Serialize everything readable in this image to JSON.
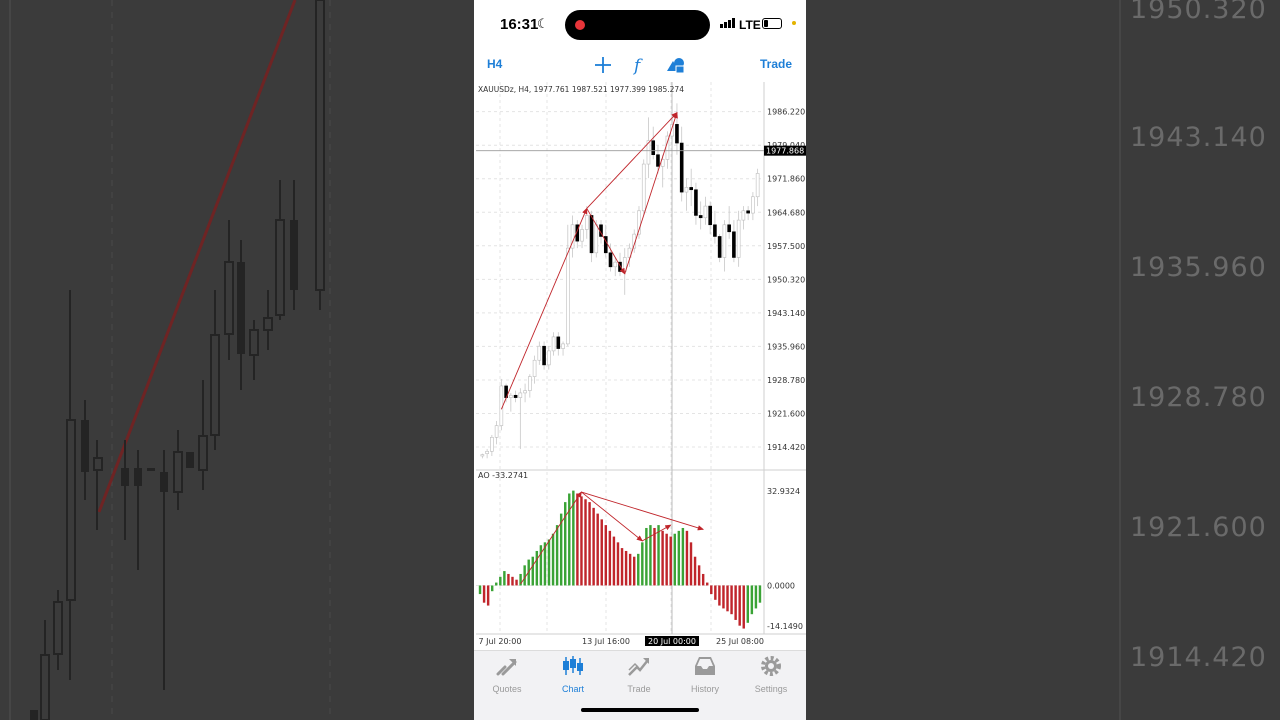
{
  "status_bar": {
    "time": "16:31",
    "network": "LTE"
  },
  "toolbar": {
    "timeframe": "H4",
    "trade_label": "Trade",
    "icons": [
      "crosshair-icon",
      "function-icon",
      "shapes-icon"
    ]
  },
  "background": {
    "tick_labels": [
      "1950.320",
      "1943.140",
      "1935.960",
      "1928.780",
      "1921.600",
      "1914.420"
    ]
  },
  "chart_data": [
    {
      "type": "candlestick",
      "title": "XAUUSDz, H4, 1977.761 1987.521 1977.399 1985.274",
      "current_price": "1977.868",
      "y_ticks": [
        "1986.220",
        "1979.040",
        "1971.860",
        "1964.680",
        "1957.500",
        "1950.320",
        "1943.140",
        "1935.960",
        "1928.780",
        "1921.600",
        "1914.420"
      ],
      "ylim": [
        1909.5,
        1990.0
      ],
      "x_ticks": [
        "7 Jul 20:00",
        "13 Jul 16:00",
        "20 Jul 00:00",
        "25 Jul 08:00"
      ],
      "highlighted_x": "20 Jul 00:00",
      "candles": [
        [
          1912.5,
          1913.0,
          1912.0,
          1912.8
        ],
        [
          1913.0,
          1914.0,
          1912.0,
          1913.5
        ],
        [
          1913.5,
          1917.0,
          1912.5,
          1916.5
        ],
        [
          1916.5,
          1920.0,
          1915.0,
          1919.0
        ],
        [
          1919.0,
          1929.0,
          1918.0,
          1927.5
        ],
        [
          1927.5,
          1928.0,
          1924.0,
          1925.0
        ],
        [
          1925.0,
          1926.0,
          1922.0,
          1925.5
        ],
        [
          1925.5,
          1926.5,
          1924.0,
          1925.0
        ],
        [
          1925.0,
          1927.0,
          1914.0,
          1926.0
        ],
        [
          1926.0,
          1928.0,
          1924.0,
          1926.5
        ],
        [
          1926.5,
          1930.0,
          1925.0,
          1929.5
        ],
        [
          1929.5,
          1934.0,
          1928.0,
          1933.0
        ],
        [
          1933.0,
          1937.0,
          1932.0,
          1936.0
        ],
        [
          1936.0,
          1937.0,
          1931.0,
          1932.0
        ],
        [
          1932.0,
          1936.0,
          1931.0,
          1935.0
        ],
        [
          1935.0,
          1939.0,
          1934.0,
          1938.0
        ],
        [
          1938.0,
          1939.0,
          1934.0,
          1935.5
        ],
        [
          1935.5,
          1937.0,
          1934.0,
          1936.5
        ],
        [
          1936.5,
          1962.0,
          1936.0,
          1957.0
        ],
        [
          1957.0,
          1964.0,
          1955.0,
          1962.0
        ],
        [
          1962.0,
          1963.0,
          1957.0,
          1958.5
        ],
        [
          1958.5,
          1962.0,
          1957.0,
          1961.0
        ],
        [
          1961.0,
          1966.0,
          1959.0,
          1964.0
        ],
        [
          1964.0,
          1965.0,
          1954.0,
          1956.0
        ],
        [
          1956.0,
          1963.0,
          1955.0,
          1962.0
        ],
        [
          1962.0,
          1963.0,
          1958.0,
          1959.5
        ],
        [
          1959.5,
          1962.0,
          1955.0,
          1956.0
        ],
        [
          1956.0,
          1958.0,
          1952.0,
          1953.0
        ],
        [
          1953.0,
          1955.0,
          1951.0,
          1954.0
        ],
        [
          1954.0,
          1956.0,
          1951.0,
          1952.0
        ],
        [
          1952.0,
          1957.0,
          1947.0,
          1955.0
        ],
        [
          1955.0,
          1958.0,
          1953.0,
          1957.0
        ],
        [
          1957.0,
          1961.0,
          1956.0,
          1960.0
        ],
        [
          1960.0,
          1966.0,
          1959.0,
          1965.0
        ],
        [
          1965.0,
          1976.0,
          1964.0,
          1975.0
        ],
        [
          1975.0,
          1985.0,
          1972.0,
          1980.0
        ],
        [
          1980.0,
          1983.0,
          1976.0,
          1977.0
        ],
        [
          1977.0,
          1979.0,
          1973.0,
          1974.5
        ],
        [
          1974.5,
          1977.0,
          1970.0,
          1976.0
        ],
        [
          1976.0,
          1982.0,
          1974.0,
          1981.0
        ],
        [
          1981.0,
          1987.0,
          1978.0,
          1983.5
        ],
        [
          1983.5,
          1988.0,
          1977.0,
          1979.5
        ],
        [
          1979.5,
          1983.0,
          1967.0,
          1969.0
        ],
        [
          1969.0,
          1972.0,
          1965.0,
          1970.0
        ],
        [
          1970.0,
          1974.0,
          1966.0,
          1969.5
        ],
        [
          1969.5,
          1971.0,
          1962.0,
          1964.0
        ],
        [
          1964.0,
          1967.0,
          1961.0,
          1963.5
        ],
        [
          1963.5,
          1968.0,
          1962.0,
          1966.0
        ],
        [
          1966.0,
          1967.0,
          1960.0,
          1962.0
        ],
        [
          1962.0,
          1965.0,
          1958.0,
          1959.5
        ],
        [
          1959.5,
          1960.0,
          1954.0,
          1955.0
        ],
        [
          1955.0,
          1963.0,
          1952.0,
          1962.0
        ],
        [
          1962.0,
          1966.0,
          1959.0,
          1960.5
        ],
        [
          1960.5,
          1963.0,
          1954.0,
          1955.0
        ],
        [
          1955.0,
          1965.0,
          1953.0,
          1963.0
        ],
        [
          1963.0,
          1966.0,
          1961.0,
          1965.0
        ],
        [
          1965.0,
          1966.0,
          1963.0,
          1964.5
        ],
        [
          1964.5,
          1969.0,
          1963.0,
          1968.0
        ],
        [
          1968.0,
          1974.0,
          1966.0,
          1973.0
        ]
      ],
      "annotations": [
        {
          "kind": "arrow",
          "from": [
            4,
            1922.5
          ],
          "to": [
            22,
            1965.5
          ]
        },
        {
          "kind": "arrow",
          "from": [
            22,
            1965.5
          ],
          "to": [
            41,
            1986.0
          ]
        },
        {
          "kind": "arrow",
          "from": [
            22,
            1965.5
          ],
          "to": [
            30,
            1951.5
          ]
        },
        {
          "kind": "arrow",
          "from": [
            30,
            1951.5
          ],
          "to": [
            41,
            1986.0
          ]
        }
      ]
    },
    {
      "type": "bar",
      "title": "AO -33.2741",
      "y_ticks": [
        "32.9324",
        "0.0000",
        "-14.1490"
      ],
      "ylim": [
        -16.2,
        36.0
      ],
      "values": [
        -3,
        -6,
        -7,
        -2,
        1,
        3,
        5,
        4,
        3,
        2,
        4,
        7,
        9,
        10,
        12,
        14,
        15,
        16,
        18,
        21,
        25,
        29,
        32,
        33,
        32,
        31,
        30,
        29,
        27,
        25,
        23,
        21,
        19,
        17,
        15,
        13,
        12,
        11,
        10,
        11,
        15,
        20,
        21,
        20,
        21,
        19,
        18,
        17,
        18,
        19,
        20,
        19,
        15,
        10,
        7,
        4,
        1,
        -3,
        -5,
        -7,
        -8,
        -9,
        -10,
        -12,
        -14,
        -15,
        -13,
        -10,
        -8,
        -6
      ],
      "annotations": [
        {
          "kind": "arrow",
          "from": [
            10,
            0.5
          ],
          "to": [
            25,
            32.5
          ]
        },
        {
          "kind": "arrow",
          "from": [
            25,
            32.5
          ],
          "to": [
            40,
            15.5
          ]
        },
        {
          "kind": "arrow",
          "from": [
            25,
            32.5
          ],
          "to": [
            55,
            19.5
          ]
        },
        {
          "kind": "arrow",
          "from": [
            40,
            15.5
          ],
          "to": [
            47,
            21.0
          ]
        }
      ]
    }
  ],
  "tabs": [
    {
      "label": "Quotes",
      "icon": "quotes-icon"
    },
    {
      "label": "Chart",
      "icon": "chart-icon",
      "active": true
    },
    {
      "label": "Trade",
      "icon": "trade-icon"
    },
    {
      "label": "History",
      "icon": "history-icon"
    },
    {
      "label": "Settings",
      "icon": "settings-icon"
    }
  ],
  "colors": {
    "accent": "#1e7fd7",
    "arrow": "#c0252b",
    "bar_up": "#3aa336",
    "bar_down": "#c0252b",
    "candle": "#000000"
  }
}
